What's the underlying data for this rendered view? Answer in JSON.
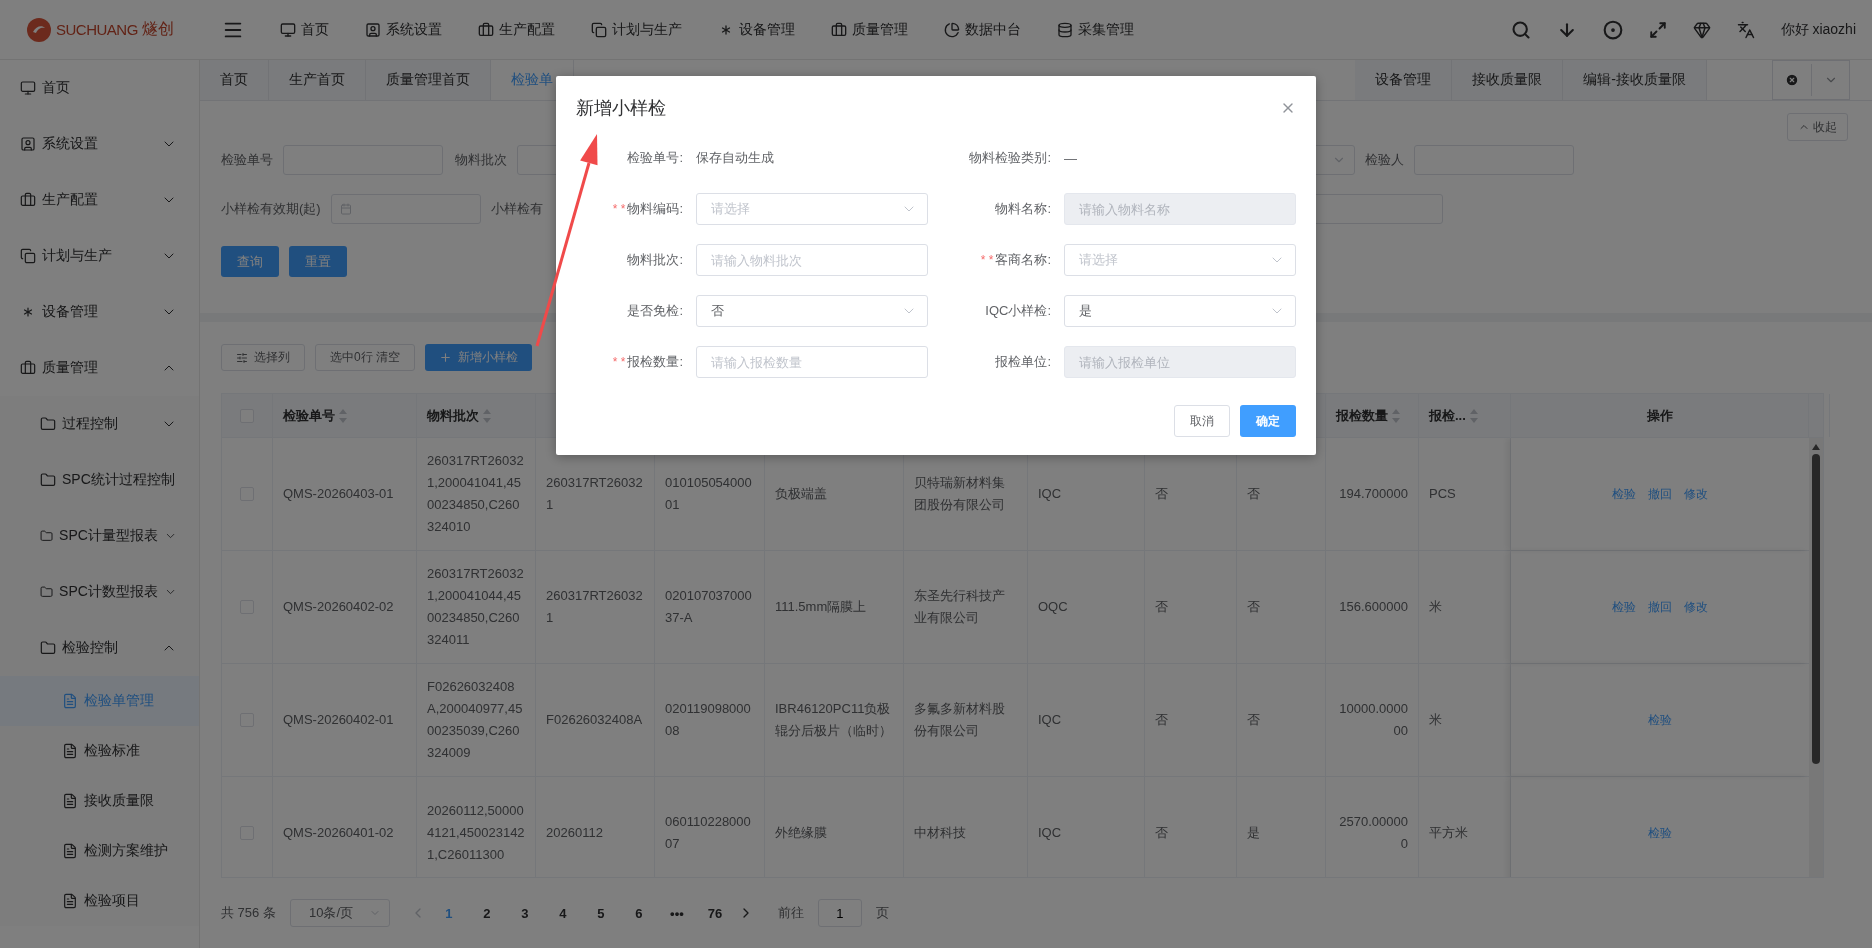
{
  "header": {
    "logo": "SUCHUANG",
    "logo_cn": "燧创",
    "nav": [
      "首页",
      "系统设置",
      "生产配置",
      "计划与生产",
      "设备管理",
      "质量管理",
      "数据中台",
      "采集管理"
    ],
    "greeting": "你好 xiaozhi"
  },
  "sidebar": {
    "items": [
      {
        "label": "首页",
        "selected": false
      },
      {
        "label": "系统设置",
        "selected": false,
        "expanded": false
      },
      {
        "label": "生产配置",
        "selected": false,
        "expanded": false
      },
      {
        "label": "计划与生产",
        "selected": false,
        "expanded": false
      },
      {
        "label": "设备管理",
        "selected": false,
        "expanded": false
      },
      {
        "label": "质量管理",
        "selected": false,
        "expanded": true,
        "children": [
          {
            "label": "过程控制",
            "selected": false,
            "expanded": false
          },
          {
            "label": "SPC统计过程控制",
            "selected": false
          },
          {
            "label": "SPC计量型报表",
            "selected": false,
            "expanded": false
          },
          {
            "label": "SPC计数型报表",
            "selected": false,
            "expanded": false
          },
          {
            "label": "检验控制",
            "selected": false,
            "expanded": true,
            "children": [
              {
                "label": "检验单管理",
                "selected": true
              },
              {
                "label": "检验标准",
                "selected": false
              },
              {
                "label": "接收质量限",
                "selected": false
              },
              {
                "label": "检测方案维护",
                "selected": false
              },
              {
                "label": "检验项目",
                "selected": false
              }
            ]
          }
        ]
      }
    ]
  },
  "tabs": {
    "left": [
      {
        "label": "首页",
        "selected": false
      },
      {
        "label": "生产首页",
        "selected": false
      },
      {
        "label": "质量管理首页",
        "selected": false
      },
      {
        "label": "检验单",
        "selected": true
      }
    ],
    "right": [
      {
        "label": "设备管理",
        "selected": false
      },
      {
        "label": "接收质量限",
        "selected": false
      },
      {
        "label": "编辑-接收质量限",
        "selected": false
      }
    ]
  },
  "filters": {
    "collapse": "收起",
    "rows": [
      {
        "left": [
          {
            "kind": "input",
            "label": "检验单号"
          },
          {
            "kind": "input",
            "label": "物料批次"
          }
        ],
        "right": [
          {
            "kind": "select"
          },
          {
            "kind": "input",
            "label": "检验人"
          }
        ]
      },
      {
        "left": [
          {
            "kind": "date",
            "label": "小样检有效期(起)"
          },
          {
            "kind": "label",
            "label": "小样检有"
          }
        ],
        "right": [
          {
            "kind": "input"
          }
        ]
      }
    ],
    "query": "查询",
    "reset": "重置"
  },
  "toolbar": {
    "columns_button": "选择列",
    "selection": "选中0行 清空",
    "add_button": "新增小样检"
  },
  "table": {
    "select_all_checked": false,
    "columns": [
      {
        "label": "检验单号",
        "sortable": true
      },
      {
        "label": "物料批次",
        "sortable": true
      },
      {},
      {},
      {},
      {},
      {},
      {},
      {},
      {
        "label": "报检数量",
        "sortable": true
      },
      {
        "label": "报检...",
        "sortable": true
      },
      {
        "label": "操作",
        "sortable": false
      }
    ],
    "rows": [
      {
        "checked": false,
        "cells": [
          "QMS-20260403-01",
          "260317RT260321,200041041,4500234850,C260324010",
          "260317RT260321",
          "01010505400001",
          "负极端盖",
          "贝特瑞新材料集团股份有限公司",
          "IQC",
          "否",
          "否",
          "194.700000",
          "PCS"
        ],
        "actions": [
          "检验",
          "撤回",
          "修改"
        ]
      },
      {
        "checked": false,
        "cells": [
          "QMS-20260402-02",
          "260317RT260321,200041044,4500234850,C260324011",
          "260317RT260321",
          "02010703700037-A",
          "111.5mm隔膜上",
          "东圣先行科技产业有限公司",
          "OQC",
          "否",
          "否",
          "156.600000",
          "米"
        ],
        "actions": [
          "检验",
          "撤回",
          "修改"
        ]
      },
      {
        "checked": false,
        "cells": [
          "QMS-20260402-01",
          "F02626032408A,200040977,4500235039,C260324009",
          "F02626032408A",
          "02011909800008",
          "IBR46120PC11负极辊分后极片（临时）",
          "多氟多新材料股份有限公司",
          "IQC",
          "否",
          "否",
          "10000.000000",
          "米"
        ],
        "actions": [
          "检验"
        ]
      },
      {
        "checked": false,
        "cells": [
          "QMS-20260401-02",
          "20260112,500004121,4500231421,C26011300",
          "20260112",
          "06011022800007",
          "外绝缘膜",
          "中材科技",
          "IQC",
          "否",
          "是",
          "2570.000000",
          "平方米"
        ],
        "actions": [
          "检验"
        ]
      }
    ]
  },
  "pagination": {
    "total": "共 756 条",
    "page_size": "10条/页",
    "pages": [
      {
        "label": "1",
        "selected": true
      },
      {
        "label": "2",
        "selected": false
      },
      {
        "label": "3",
        "selected": false
      },
      {
        "label": "4",
        "selected": false
      },
      {
        "label": "5",
        "selected": false
      },
      {
        "label": "6",
        "selected": false
      },
      {
        "label": "•••",
        "selected": false
      },
      {
        "label": "76",
        "selected": false
      }
    ],
    "goto_label": "前往",
    "goto_value": "1",
    "page_suffix": "页"
  },
  "dialog": {
    "title": "新增小样检",
    "fields": [
      {
        "label": "检验单号:",
        "kind": "text",
        "value": "保存自动生成"
      },
      {
        "label": "物料检验类别:",
        "kind": "text",
        "value": "—"
      },
      {
        "label": "物料编码:",
        "mark": "* *",
        "kind": "select",
        "placeholder": "请选择"
      },
      {
        "label": "物料名称:",
        "kind": "input",
        "placeholder": "请输入物料名称",
        "disabled": true
      },
      {
        "label": "物料批次:",
        "kind": "input",
        "placeholder": "请输入物料批次",
        "disabled": false
      },
      {
        "label": "客商名称:",
        "mark": "* *",
        "kind": "select",
        "placeholder": "请选择"
      },
      {
        "label": "是否免检:",
        "kind": "select",
        "value": "否"
      },
      {
        "label": "IQC小样检:",
        "kind": "select",
        "value": "是"
      },
      {
        "label": "报检数量:",
        "mark": "* *",
        "kind": "input",
        "placeholder": "请输入报检数量",
        "disabled": false
      },
      {
        "label": "报检单位:",
        "kind": "input",
        "placeholder": "请输入报检单位",
        "disabled": true
      }
    ],
    "cancel": "取消",
    "confirm": "确定"
  }
}
